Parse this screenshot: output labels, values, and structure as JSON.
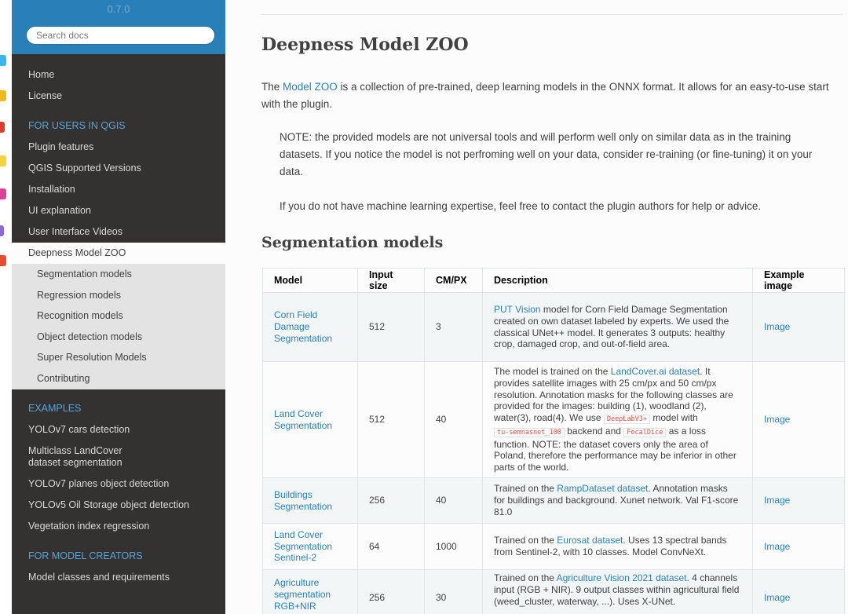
{
  "sidebar": {
    "version": "0.7.0",
    "search_placeholder": "Search docs",
    "top_items": [
      "Home",
      "License"
    ],
    "sections": [
      {
        "caption": "FOR USERS IN QGIS",
        "items": [
          "Plugin features",
          "QGIS Supported Versions",
          "Installation",
          "UI explanation",
          "User Interface Videos"
        ]
      }
    ],
    "current_item": "Deepness Model ZOO",
    "sub_items": [
      "Segmentation models",
      "Regression models",
      "Recognition models",
      "Object detection models",
      "Super Resolution Models",
      "Contributing"
    ],
    "examples_caption": "EXAMPLES",
    "examples_items": [
      "YOLOv7 cars detection",
      "Multiclass LandCover dataset segmentation",
      "YOLOv7 planes object detection",
      "YOLOv5 Oil Storage object detection",
      "Vegetation index regression"
    ],
    "creators_caption": "FOR MODEL CREATORS",
    "creators_items": [
      "Model classes and requirements"
    ]
  },
  "main": {
    "title": "Deepness Model ZOO",
    "intro_prefix": "The ",
    "intro_link": "Model ZOO",
    "intro_rest": " is a collection of pre-trained, deep learning models in the ONNX format. It allows for an easy-to-use start with the plugin.",
    "note": "NOTE: the provided models are not universal tools and will perform well only on similar data as in the training datasets. If you notice the model is not perfroming well on your data, consider re-training (or fine-tuning) it on your data.",
    "contact": "If you do not have machine learning expertise, feel free to contact the plugin authors for help or advice.",
    "section_title": "Segmentation models",
    "table": {
      "headers": [
        "Model",
        "Input size",
        "CM/PX",
        "Description",
        "Example image"
      ],
      "rows": [
        {
          "model": "Corn Field Damage Segmentation",
          "input": "512",
          "cmpx": "3",
          "desc_link": "PUT Vision",
          "desc": " model for Corn Field Damage Segmentation created on own dataset labeled by experts. We used the classical UNet++ model. It generates 3 outputs: healthy crop, damaged crop, and out-of-field area.",
          "image": "Image"
        },
        {
          "model": "Land Cover Segmentation",
          "input": "512",
          "cmpx": "40",
          "desc_a": "The model is trained on the ",
          "desc_link": "LandCover.ai dataset",
          "desc_b": ". It provides satellite images with 25 cm/px and 50 cm/px resolution. Annotation masks for the following classes are provided for the images: building (1), woodland (2), water(3), road(4). We use ",
          "code1": "DeepLabV3+",
          "desc_c": " model with ",
          "code2": "tu-semnasnet_100",
          "desc_d": " backend and ",
          "code3": "FocalDice",
          "desc_e": " as a loss function. NOTE: the dataset covers only the area of Poland, therefore the performance may be inferior in other parts of the world.",
          "image": "Image"
        },
        {
          "model": "Buildings Segmentation",
          "input": "256",
          "cmpx": "40",
          "desc_a": "Trained on the ",
          "desc_link": "RampDataset dataset",
          "desc_b": ". Annotation masks for buildings and background. Xunet network. Val F1-score 81.0",
          "image": "Image"
        },
        {
          "model": "Land Cover Segmentation Sentinel-2",
          "input": "64",
          "cmpx": "1000",
          "desc_a": "Trained on the ",
          "desc_link": "Eurosat dataset",
          "desc_b": ". Uses 13 spectral bands from Sentinel-2, with 10 classes. Model ConvNeXt.",
          "image": "Image"
        },
        {
          "model": "Agriculture segmentation RGB+NIR",
          "input": "256",
          "cmpx": "30",
          "desc_a": "Trained on the ",
          "desc_link": "Agriculture Vision 2021 dataset",
          "desc_b": ". 4 channels input (RGB + NIR). 9 output classes within agricultural field (weed_cluster, waterway, ...). Uses X-UNet.",
          "image": "Image"
        }
      ]
    }
  },
  "colors": {
    "sidebar_bg": "#343131",
    "sidebar_header": "#2980b9",
    "caption": "#55a5d9",
    "link": "#2980b9"
  }
}
